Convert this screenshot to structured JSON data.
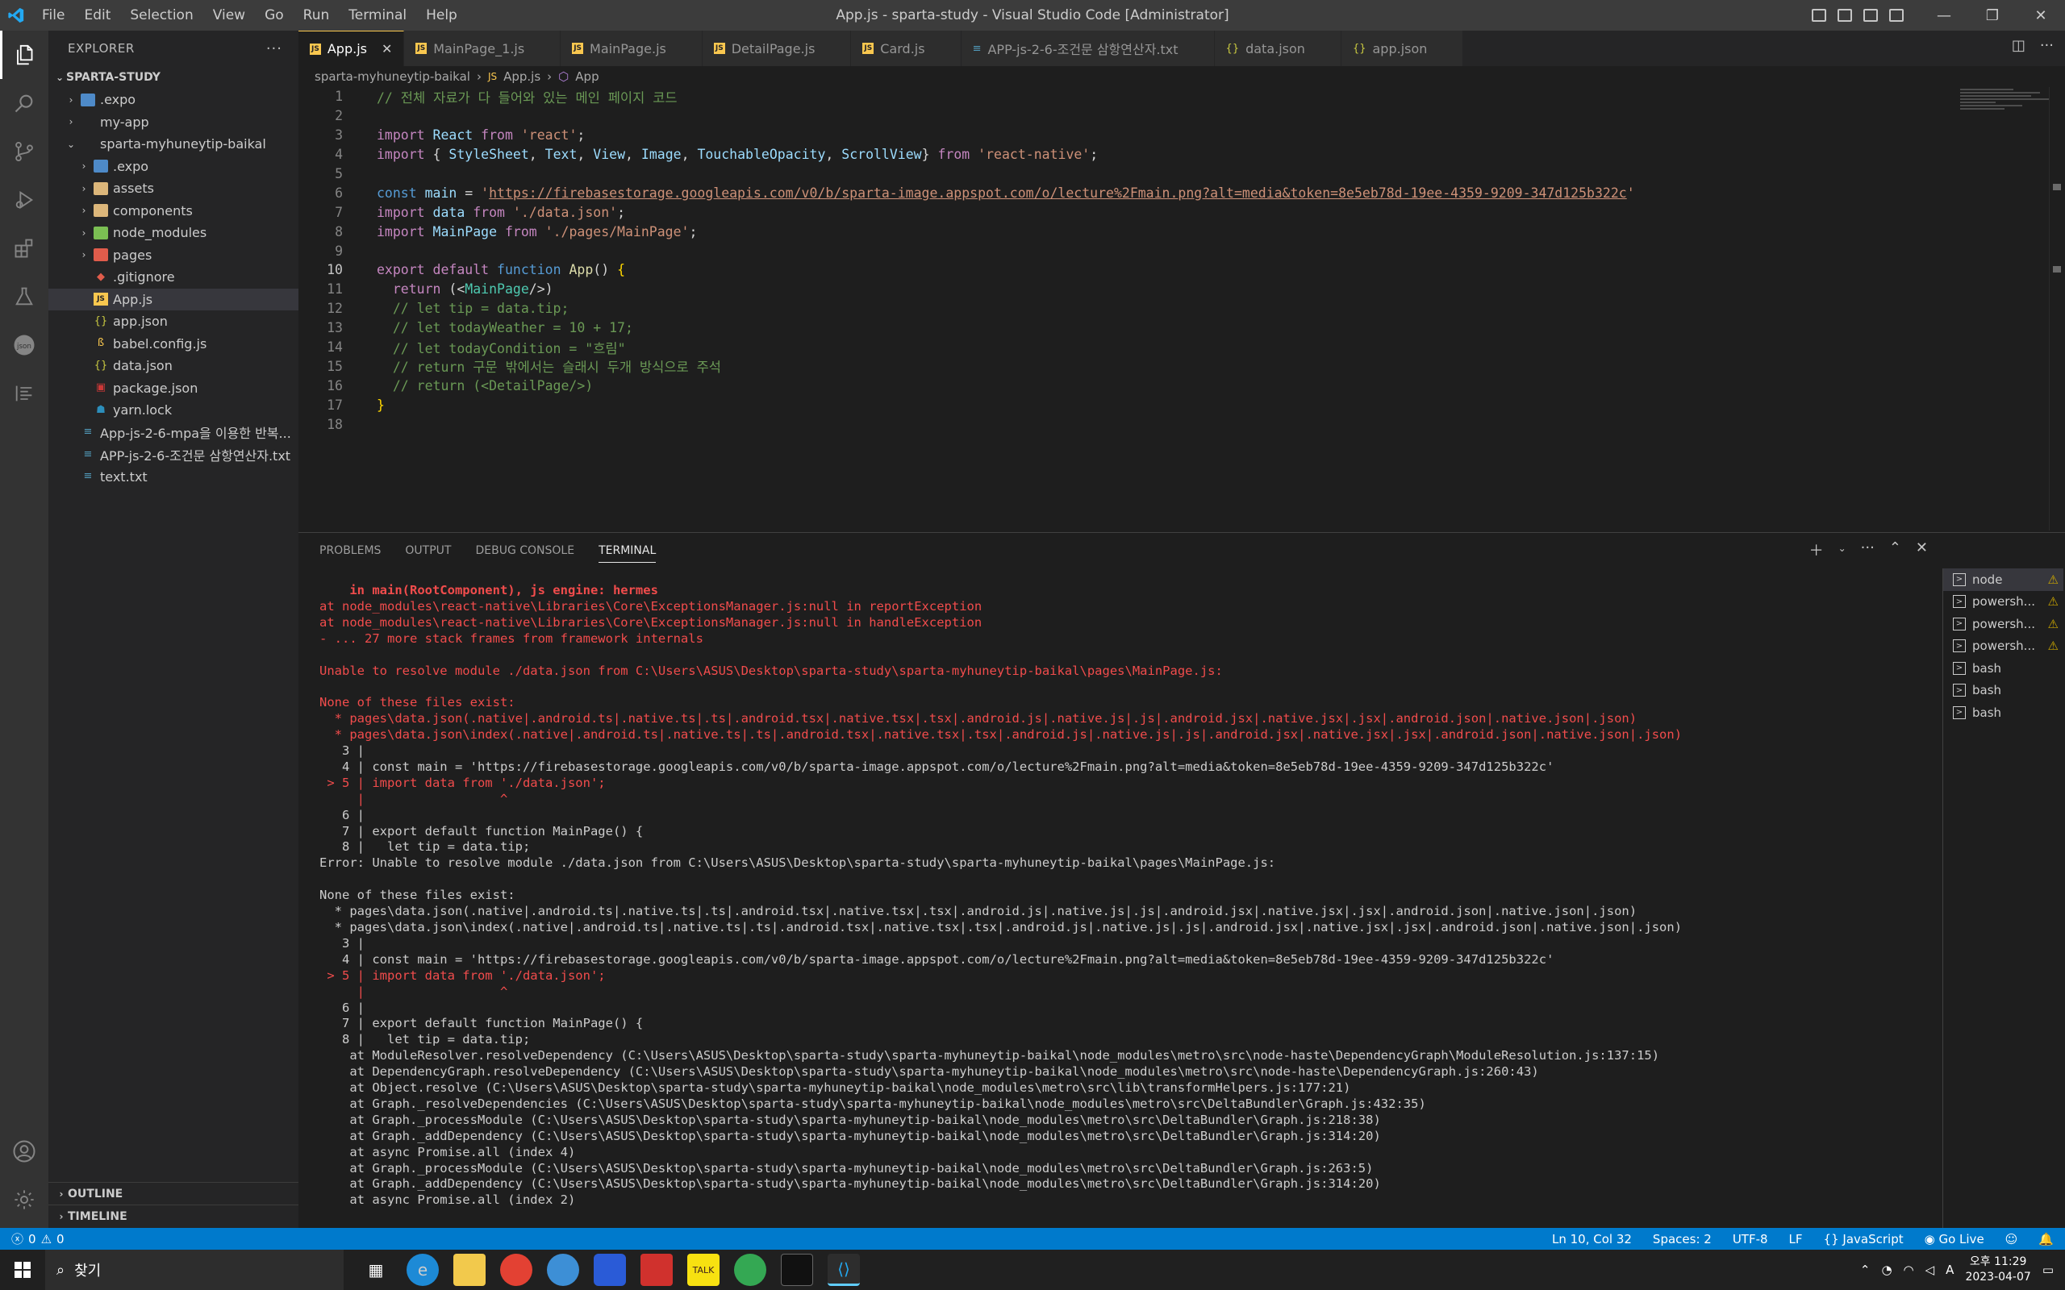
{
  "window": {
    "title": "App.js - sparta-study - Visual Studio Code [Administrator]"
  },
  "menu": [
    "File",
    "Edit",
    "Selection",
    "View",
    "Go",
    "Run",
    "Terminal",
    "Help"
  ],
  "explorer": {
    "header": "EXPLORER",
    "root": "SPARTA-STUDY",
    "items": [
      {
        "label": ".expo",
        "level": 1,
        "kind": "folder-blue",
        "chev": "›"
      },
      {
        "label": "my-app",
        "level": 1,
        "kind": "none",
        "chev": "›"
      },
      {
        "label": "sparta-myhuneytip-baikal",
        "level": 1,
        "kind": "none",
        "chev": "⌄"
      },
      {
        "label": ".expo",
        "level": 2,
        "kind": "folder-blue",
        "chev": "›"
      },
      {
        "label": "assets",
        "level": 2,
        "kind": "folder",
        "chev": "›"
      },
      {
        "label": "components",
        "level": 2,
        "kind": "folder",
        "chev": "›"
      },
      {
        "label": "node_modules",
        "level": 2,
        "kind": "folder-green",
        "chev": "›"
      },
      {
        "label": "pages",
        "level": 2,
        "kind": "folder-red",
        "chev": "›"
      },
      {
        "label": ".gitignore",
        "level": 2,
        "kind": "git",
        "chev": ""
      },
      {
        "label": "App.js",
        "level": 2,
        "kind": "js",
        "chev": ""
      },
      {
        "label": "app.json",
        "level": 2,
        "kind": "json",
        "chev": ""
      },
      {
        "label": "babel.config.js",
        "level": 2,
        "kind": "babel",
        "chev": ""
      },
      {
        "label": "data.json",
        "level": 2,
        "kind": "json",
        "chev": ""
      },
      {
        "label": "package.json",
        "level": 2,
        "kind": "npm",
        "chev": ""
      },
      {
        "label": "yarn.lock",
        "level": 2,
        "kind": "yarn",
        "chev": ""
      },
      {
        "label": "App-js-2-6-mpa을 이용한 반복...",
        "level": 1,
        "kind": "txt",
        "chev": ""
      },
      {
        "label": "APP-js-2-6-조건문 삼항연산자.txt",
        "level": 1,
        "kind": "txt",
        "chev": ""
      },
      {
        "label": "text.txt",
        "level": 1,
        "kind": "txt",
        "chev": ""
      }
    ],
    "outline": "OUTLINE",
    "timeline": "TIMELINE"
  },
  "tabs": [
    {
      "label": "App.js",
      "icon": "JS",
      "active": true
    },
    {
      "label": "MainPage_1.js",
      "icon": "JS"
    },
    {
      "label": "MainPage.js",
      "icon": "JS"
    },
    {
      "label": "DetailPage.js",
      "icon": "JS"
    },
    {
      "label": "Card.js",
      "icon": "JS"
    },
    {
      "label": "APP-js-2-6-조건문 삼항연산자.txt",
      "icon": "≡"
    },
    {
      "label": "data.json",
      "icon": "{}"
    },
    {
      "label": "app.json",
      "icon": "{}"
    }
  ],
  "breadcrumb": [
    "sparta-myhuneytip-baikal",
    "App.js",
    "App"
  ],
  "code": [
    {
      "n": "1",
      "html": "<span class='cm'>// 전체 자료가 다 들어와 있는 메인 페이지 코드</span>"
    },
    {
      "n": "2",
      "html": ""
    },
    {
      "n": "3",
      "html": "<span class='kw2'>import</span> <span class='var'>React</span> <span class='kw2'>from</span> <span class='str'>'react'</span>;"
    },
    {
      "n": "4",
      "html": "<span class='kw2'>import</span> { <span class='var'>StyleSheet</span>, <span class='var'>Text</span>, <span class='var'>View</span>, <span class='var'>Image</span>, <span class='var'>TouchableOpacity</span>, <span class='var'>ScrollView</span>} <span class='kw2'>from</span> <span class='str'>'react-native'</span>;"
    },
    {
      "n": "5",
      "html": ""
    },
    {
      "n": "6",
      "html": "<span class='kw'>const</span> <span class='var'>main</span> = <span class='str'>'<u>https://firebasestorage.googleapis.com/v0/b/sparta-image.appspot.com/o/lecture%2Fmain.png?alt=media&amp;token=8e5eb78d-19ee-4359-9209-347d125b322c</u>'</span>"
    },
    {
      "n": "7",
      "html": "<span class='kw2'>import</span> <span class='var'>data</span> <span class='kw2'>from</span> <span class='str'>'./data.json'</span>;"
    },
    {
      "n": "8",
      "html": "<span class='kw2'>import</span> <span class='var'>MainPage</span> <span class='kw2'>from</span> <span class='str'>'./pages/MainPage'</span>;"
    },
    {
      "n": "9",
      "html": ""
    },
    {
      "n": "10",
      "html": "<span class='kw2'>export</span> <span class='kw2'>default</span> <span class='kw'>function</span> <span class='fn'>App</span>() <span class='br'>{</span>",
      "cur": true
    },
    {
      "n": "11",
      "html": "  <span class='kw2'>return</span> (&lt;<span class='tag'>MainPage</span>/&gt;)"
    },
    {
      "n": "12",
      "html": "  <span class='cm'>// let tip = data.tip;</span>"
    },
    {
      "n": "13",
      "html": "  <span class='cm'>// let todayWeather = 10 + 17;</span>"
    },
    {
      "n": "14",
      "html": "  <span class='cm'>// let todayCondition = \"흐림\"</span>"
    },
    {
      "n": "15",
      "html": "  <span class='cm'>// return 구문 밖에서는 슬래시 두개 방식으로 주석</span>"
    },
    {
      "n": "16",
      "html": "  <span class='cm'>// return (&lt;DetailPage/&gt;)</span>"
    },
    {
      "n": "17",
      "html": "<span class='br'>}</span>"
    },
    {
      "n": "18",
      "html": ""
    }
  ],
  "panel": {
    "tabs": [
      "PROBLEMS",
      "OUTPUT",
      "DEBUG CONSOLE",
      "TERMINAL"
    ],
    "active": "TERMINAL"
  },
  "terminal": [
    {
      "c": "tr-bred",
      "t": "    in main(RootComponent), js engine: hermes"
    },
    {
      "c": "tr-red",
      "t": "at node_modules\\react-native\\Libraries\\Core\\ExceptionsManager.js:null in reportException"
    },
    {
      "c": "tr-red",
      "t": "at node_modules\\react-native\\Libraries\\Core\\ExceptionsManager.js:null in handleException"
    },
    {
      "c": "tr-red",
      "t": "- ... 27 more stack frames from framework internals"
    },
    {
      "c": "tr-red",
      "t": ""
    },
    {
      "c": "tr-red",
      "t": "Unable to resolve module ./data.json from C:\\Users\\ASUS\\Desktop\\sparta-study\\sparta-myhuneytip-baikal\\pages\\MainPage.js:"
    },
    {
      "c": "tr-red",
      "t": ""
    },
    {
      "c": "tr-red",
      "t": "None of these files exist:"
    },
    {
      "c": "tr-red",
      "t": "  * pages\\data.json(.native|.android.ts|.native.ts|.ts|.android.tsx|.native.tsx|.tsx|.android.js|.native.js|.js|.android.jsx|.native.jsx|.jsx|.android.json|.native.json|.json)"
    },
    {
      "c": "tr-red",
      "t": "  * pages\\data.json\\index(.native|.android.ts|.native.ts|.ts|.android.tsx|.native.tsx|.tsx|.android.js|.native.js|.js|.android.jsx|.native.jsx|.jsx|.android.json|.native.json|.json)"
    },
    {
      "c": "tr-gray",
      "t": "   3 |"
    },
    {
      "c": "tr-gray",
      "t": "   4 | const main = 'https://firebasestorage.googleapis.com/v0/b/sparta-image.appspot.com/o/lecture%2Fmain.png?alt=media&token=8e5eb78d-19ee-4359-9209-347d125b322c'"
    },
    {
      "c": "tr-red",
      "t": " > 5 | import data from './data.json';"
    },
    {
      "c": "tr-red",
      "t": "     |                  ^"
    },
    {
      "c": "tr-gray",
      "t": "   6 |"
    },
    {
      "c": "tr-gray",
      "t": "   7 | export default function MainPage() {"
    },
    {
      "c": "tr-gray",
      "t": "   8 |   let tip = data.tip;"
    },
    {
      "c": "tr-gray",
      "t": "Error: Unable to resolve module ./data.json from C:\\Users\\ASUS\\Desktop\\sparta-study\\sparta-myhuneytip-baikal\\pages\\MainPage.js:"
    },
    {
      "c": "tr-gray",
      "t": ""
    },
    {
      "c": "tr-gray",
      "t": "None of these files exist:"
    },
    {
      "c": "tr-gray",
      "t": "  * pages\\data.json(.native|.android.ts|.native.ts|.ts|.android.tsx|.native.tsx|.tsx|.android.js|.native.js|.js|.android.jsx|.native.jsx|.jsx|.android.json|.native.json|.json)"
    },
    {
      "c": "tr-gray",
      "t": "  * pages\\data.json\\index(.native|.android.ts|.native.ts|.ts|.android.tsx|.native.tsx|.tsx|.android.js|.native.js|.js|.android.jsx|.native.jsx|.jsx|.android.json|.native.json|.json)"
    },
    {
      "c": "tr-gray",
      "t": "   3 |"
    },
    {
      "c": "tr-gray",
      "t": "   4 | const main = 'https://firebasestorage.googleapis.com/v0/b/sparta-image.appspot.com/o/lecture%2Fmain.png?alt=media&token=8e5eb78d-19ee-4359-9209-347d125b322c'"
    },
    {
      "c": "tr-red",
      "t": " > 5 | import data from './data.json';"
    },
    {
      "c": "tr-red",
      "t": "     |                  ^"
    },
    {
      "c": "tr-gray",
      "t": "   6 |"
    },
    {
      "c": "tr-gray",
      "t": "   7 | export default function MainPage() {"
    },
    {
      "c": "tr-gray",
      "t": "   8 |   let tip = data.tip;"
    },
    {
      "c": "tr-gray",
      "t": "    at ModuleResolver.resolveDependency (C:\\Users\\ASUS\\Desktop\\sparta-study\\sparta-myhuneytip-baikal\\node_modules\\metro\\src\\node-haste\\DependencyGraph\\ModuleResolution.js:137:15)"
    },
    {
      "c": "tr-gray",
      "t": "    at DependencyGraph.resolveDependency (C:\\Users\\ASUS\\Desktop\\sparta-study\\sparta-myhuneytip-baikal\\node_modules\\metro\\src\\node-haste\\DependencyGraph.js:260:43)"
    },
    {
      "c": "tr-gray",
      "t": "    at Object.resolve (C:\\Users\\ASUS\\Desktop\\sparta-study\\sparta-myhuneytip-baikal\\node_modules\\metro\\src\\lib\\transformHelpers.js:177:21)"
    },
    {
      "c": "tr-gray",
      "t": "    at Graph._resolveDependencies (C:\\Users\\ASUS\\Desktop\\sparta-study\\sparta-myhuneytip-baikal\\node_modules\\metro\\src\\DeltaBundler\\Graph.js:432:35)"
    },
    {
      "c": "tr-gray",
      "t": "    at Graph._processModule (C:\\Users\\ASUS\\Desktop\\sparta-study\\sparta-myhuneytip-baikal\\node_modules\\metro\\src\\DeltaBundler\\Graph.js:218:38)"
    },
    {
      "c": "tr-gray",
      "t": "    at Graph._addDependency (C:\\Users\\ASUS\\Desktop\\sparta-study\\sparta-myhuneytip-baikal\\node_modules\\metro\\src\\DeltaBundler\\Graph.js:314:20)"
    },
    {
      "c": "tr-gray",
      "t": "    at async Promise.all (index 4)"
    },
    {
      "c": "tr-gray",
      "t": "    at Graph._processModule (C:\\Users\\ASUS\\Desktop\\sparta-study\\sparta-myhuneytip-baikal\\node_modules\\metro\\src\\DeltaBundler\\Graph.js:263:5)"
    },
    {
      "c": "tr-gray",
      "t": "    at Graph._addDependency (C:\\Users\\ASUS\\Desktop\\sparta-study\\sparta-myhuneytip-baikal\\node_modules\\metro\\src\\DeltaBundler\\Graph.js:314:20)"
    },
    {
      "c": "tr-gray",
      "t": "    at async Promise.all (index 2)"
    }
  ],
  "terminals": [
    {
      "label": "node",
      "warn": true,
      "active": true
    },
    {
      "label": "powersh...",
      "warn": true
    },
    {
      "label": "powersh...",
      "warn": true
    },
    {
      "label": "powersh...",
      "warn": true
    },
    {
      "label": "bash"
    },
    {
      "label": "bash"
    },
    {
      "label": "bash"
    }
  ],
  "status": {
    "errors": "0",
    "warnings": "0",
    "position": "Ln 10, Col 32",
    "spaces": "Spaces: 2",
    "encoding": "UTF-8",
    "eol": "LF",
    "language": "JavaScript",
    "golive": "Go Live"
  },
  "taskbar": {
    "search": "찾기",
    "time": "오후 11:29",
    "date": "2023-04-07",
    "lang": "A"
  }
}
